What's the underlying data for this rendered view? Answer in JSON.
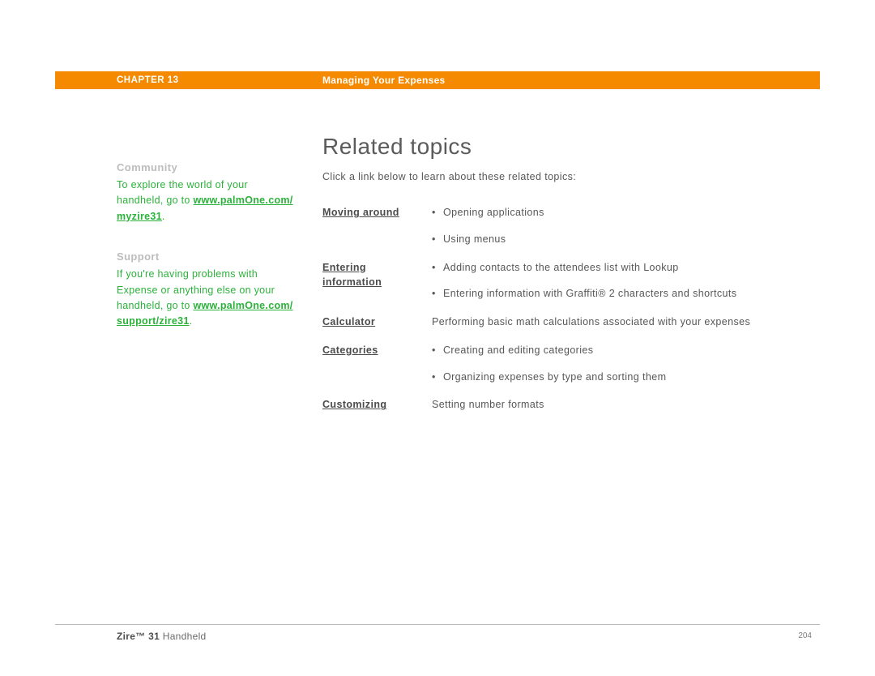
{
  "header": {
    "chapter": "CHAPTER 13",
    "title": "Managing Your Expenses"
  },
  "sidebar": {
    "community": {
      "heading": "Community",
      "text_before": "To explore the world of your handheld, go to ",
      "link": "www.palmOne.com/ myzire31",
      "text_after": "."
    },
    "support": {
      "heading": "Support",
      "text_before": "If you're having problems with Expense or anything else on your handheld, go to ",
      "link": "www.palmOne.com/ support/zire31",
      "text_after": "."
    }
  },
  "main": {
    "title": "Related topics",
    "intro": "Click a link below to learn about these related topics:",
    "topics": [
      {
        "label_lines": [
          "Moving around"
        ],
        "bullets": [
          "Opening applications",
          "Using menus"
        ]
      },
      {
        "label_lines": [
          "Entering",
          "information"
        ],
        "bullets": [
          "Adding contacts to the attendees list with Lookup",
          "Entering information with Graffiti® 2 characters and shortcuts"
        ]
      },
      {
        "label_lines": [
          "Calculator"
        ],
        "description": "Performing basic math calculations associated with your expenses"
      },
      {
        "label_lines": [
          "Categories"
        ],
        "bullets": [
          "Creating and editing categories",
          "Organizing expenses by type and sorting them"
        ]
      },
      {
        "label_lines": [
          "Customizing"
        ],
        "description": "Setting number formats"
      }
    ]
  },
  "footer": {
    "product_bold": "Zire™ 31",
    "product_rest": " Handheld",
    "page": "204"
  }
}
